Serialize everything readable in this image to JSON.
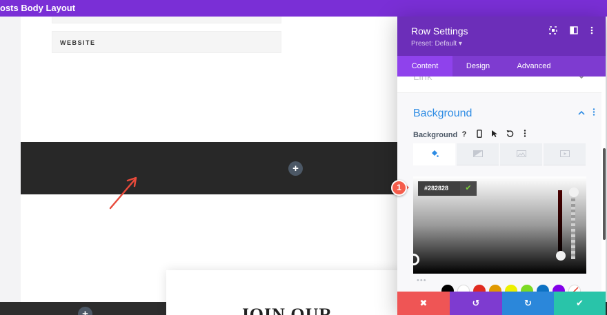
{
  "window": {
    "title": "osts Body Layout"
  },
  "canvas": {
    "field_label": "WEBSITE",
    "add_icon": "+",
    "join_heading": "JOIN OUR"
  },
  "panel": {
    "title": "Row Settings",
    "preset": "Preset: Default ▾",
    "tabs": [
      {
        "label": "Content",
        "active": true
      },
      {
        "label": "Design"
      },
      {
        "label": "Advanced"
      }
    ],
    "collapsed_section": "Link",
    "section_title": "Background",
    "field_label": "Background",
    "field_icons": [
      "question-icon",
      "mobile-icon",
      "hover-cursor-icon",
      "reset-icon",
      "more-icon"
    ],
    "bg_types": [
      "paint-bucket-icon",
      "gradient-icon",
      "image-icon",
      "video-icon"
    ],
    "color_hex": "#282828",
    "swatch_colors": [
      "#000000",
      "#ffffff",
      "#e02b20",
      "#e09900",
      "#edf000",
      "#7cda24",
      "#0c71c3",
      "#8300e9",
      "#ffffff"
    ]
  },
  "actions": {
    "cancel": "✖",
    "undo": "↺",
    "redo": "↻",
    "save": "✔",
    "colors": {
      "cancel": "#ef5555",
      "undo": "#7e3bd0",
      "redo": "#2b87da",
      "save": "#29c4a9"
    }
  },
  "annotation": {
    "step": "1"
  },
  "colors": {
    "accent_purple": "#7e3bd0",
    "link_blue": "#2e8ce4",
    "badge_red": "#f55d4c"
  }
}
